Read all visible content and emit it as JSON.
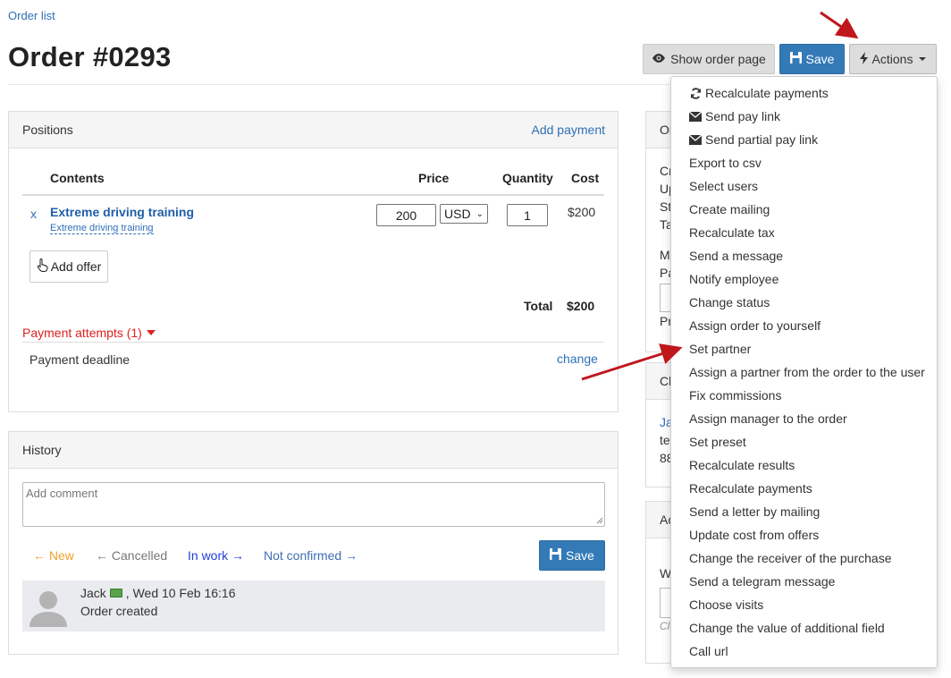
{
  "breadcrumb": "Order list",
  "title": "Order #0293",
  "header_buttons": {
    "show_order": "Show order page",
    "save": "Save",
    "actions": "Actions"
  },
  "positions": {
    "title": "Positions",
    "add_payment": "Add payment",
    "columns": {
      "contents": "Contents",
      "price": "Price",
      "quantity": "Quantity",
      "cost": "Cost"
    },
    "row": {
      "remove": "x",
      "name": "Extreme driving training",
      "offer": "Extreme driving training",
      "price": "200",
      "currency": "USD",
      "quantity": "1",
      "cost": "$200"
    },
    "add_offer": "Add offer",
    "total_label": "Total",
    "total_value": "$200",
    "payment_attempts": "Payment attempts (1)",
    "payment_deadline": "Payment deadline",
    "change": "change"
  },
  "history": {
    "title": "History",
    "comment_placeholder": "Add comment",
    "statuses": {
      "new": "New",
      "cancelled": "Cancelled",
      "in_work": "In work",
      "not_confirmed": "Not confirmed"
    },
    "status_colors": {
      "new": "#f0a02c",
      "cancelled": "#777777",
      "in_work": "#1f3fd8",
      "not_confirmed": "#3d6fb0"
    },
    "save": "Save",
    "entry": {
      "author": "Jack",
      "date": ", Wed 10 Feb 16:16",
      "text": "Order created"
    }
  },
  "side_fragments": {
    "panel1_head": "Or",
    "panel1_lines": [
      "Cr",
      "Up",
      "St",
      "Ta"
    ],
    "panel1_extra": [
      "M",
      "Pa",
      "Pr"
    ],
    "panel2_head": "Cl",
    "panel2_lines": [
      "Ja",
      "te",
      "88"
    ],
    "panel3_head": "Ac",
    "panel3_lines": [
      "W",
      "Cl"
    ]
  },
  "actions_menu": [
    {
      "label": "Recalculate payments",
      "icon": "refresh-icon"
    },
    {
      "label": "Send pay link",
      "icon": "envelope-icon"
    },
    {
      "label": "Send partial pay link",
      "icon": "envelope-icon"
    },
    {
      "label": "Export to csv",
      "icon": ""
    },
    {
      "label": "Select users",
      "icon": ""
    },
    {
      "label": "Create mailing",
      "icon": ""
    },
    {
      "label": "Recalculate tax",
      "icon": ""
    },
    {
      "label": "Send a message",
      "icon": ""
    },
    {
      "label": "Notify employee",
      "icon": ""
    },
    {
      "label": "Change status",
      "icon": ""
    },
    {
      "label": "Assign order to yourself",
      "icon": ""
    },
    {
      "label": "Set partner",
      "icon": ""
    },
    {
      "label": "Assign a partner from the order to the user",
      "icon": ""
    },
    {
      "label": "Fix commissions",
      "icon": ""
    },
    {
      "label": "Assign manager to the order",
      "icon": ""
    },
    {
      "label": "Set preset",
      "icon": ""
    },
    {
      "label": "Recalculate results",
      "icon": ""
    },
    {
      "label": "Recalculate payments",
      "icon": ""
    },
    {
      "label": "Send a letter by mailing",
      "icon": ""
    },
    {
      "label": "Update cost from offers",
      "icon": ""
    },
    {
      "label": "Change the receiver of the purchase",
      "icon": ""
    },
    {
      "label": "Send a telegram message",
      "icon": ""
    },
    {
      "label": "Choose visits",
      "icon": ""
    },
    {
      "label": "Change the value of additional field",
      "icon": ""
    },
    {
      "label": "Call url",
      "icon": ""
    }
  ],
  "colors": {
    "primary": "#337ab7",
    "link": "#2f6fb5",
    "danger": "#e02020",
    "annotation_arrow": "#c0171d"
  }
}
